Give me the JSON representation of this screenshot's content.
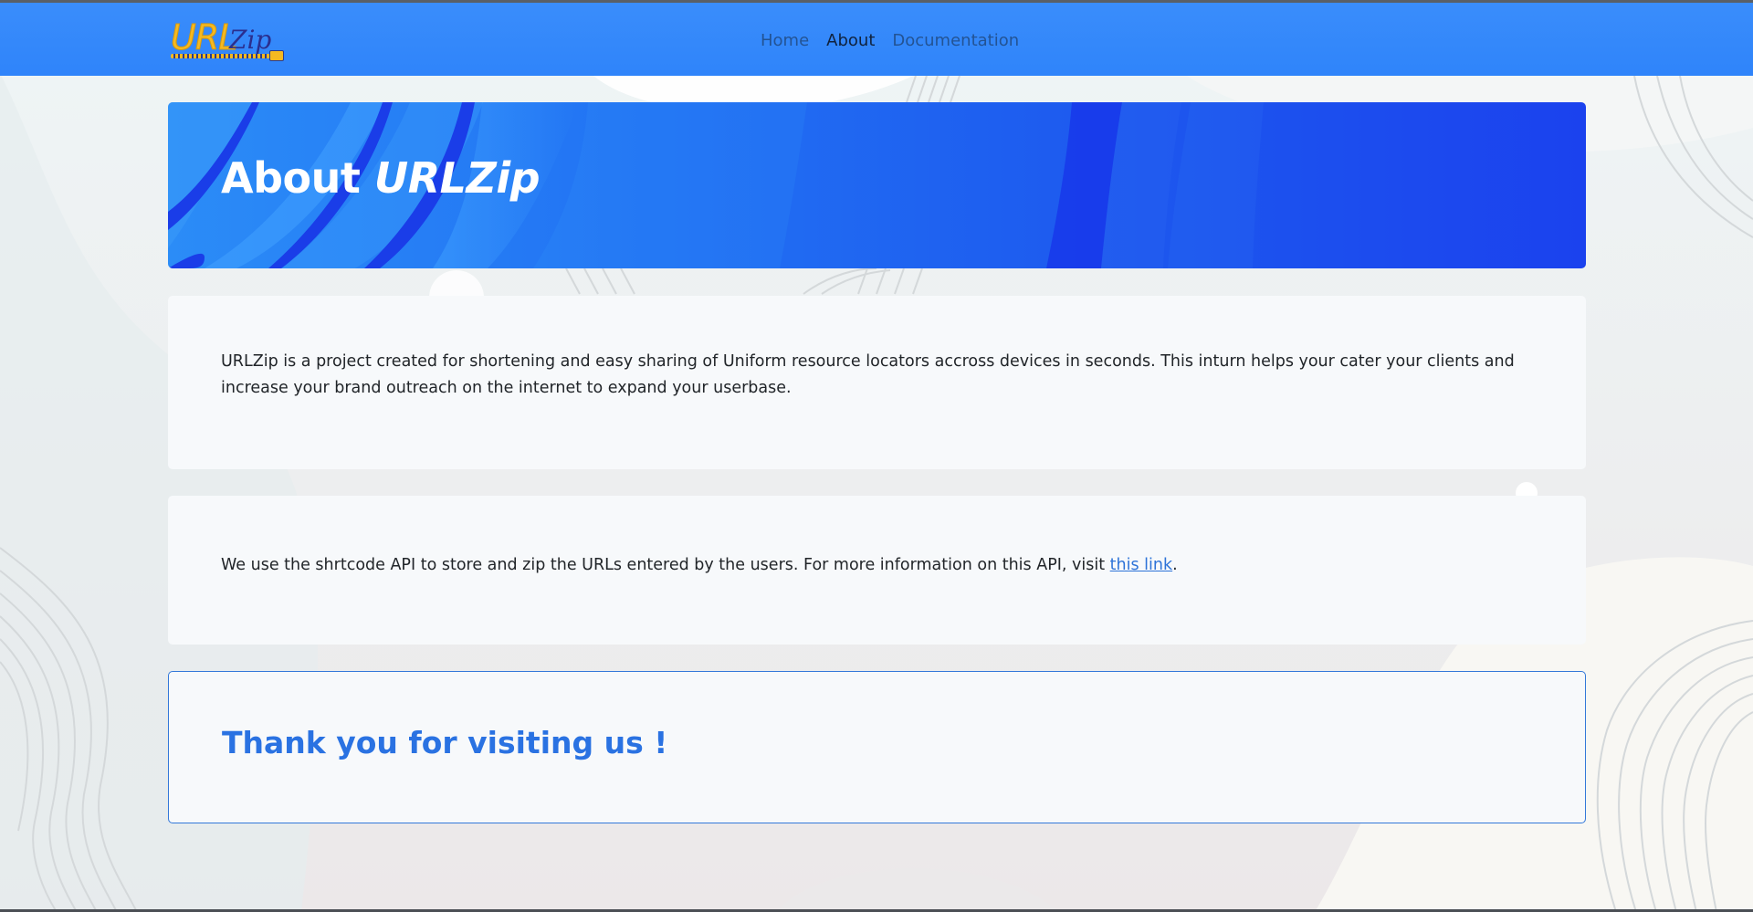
{
  "logo": {
    "main": "URL",
    "script": "Zip"
  },
  "nav": {
    "home": "Home",
    "about": "About",
    "documentation": "Documentation"
  },
  "hero": {
    "title_plain": "About ",
    "title_emphasis": "URLZip"
  },
  "about_card": {
    "text": "URLZip is a project created for shortening and easy sharing of Uniform resource locators accross devices in seconds. This inturn helps your cater your clients and increase your brand outreach on the internet to expand your userbase."
  },
  "api_card": {
    "text_before": "We use the shrtcode API to store and zip the URLs entered by the users. For more information on this API, visit ",
    "link_text": "this link",
    "text_after": "."
  },
  "thanks_card": {
    "heading": "Thank you for visiting us !"
  },
  "colors": {
    "navbar": "#2f84fa",
    "hero_start": "#2b8cf7",
    "hero_end": "#1b42ee",
    "accent": "#2a72e2",
    "logo_gold": "#f5b921"
  }
}
